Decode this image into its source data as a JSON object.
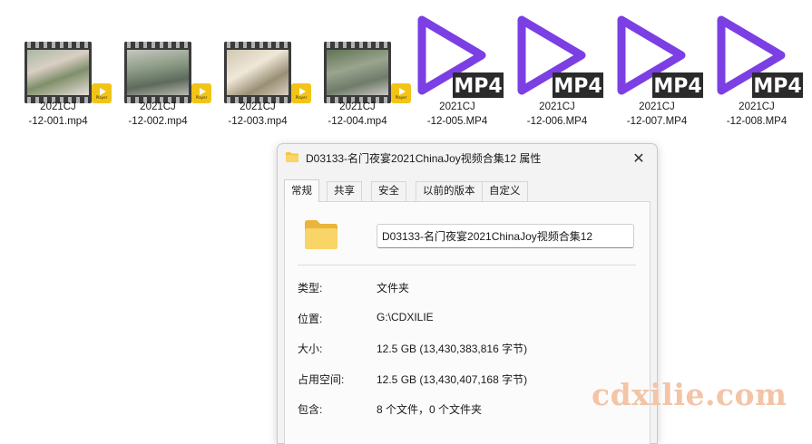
{
  "files": [
    {
      "line1": "2021CJ",
      "line2": "-12-001.mp4",
      "icon": "video-thumbnail",
      "badge": "Player"
    },
    {
      "line1": "2021CJ",
      "line2": "-12-002.mp4",
      "icon": "video-thumbnail",
      "badge": "Player"
    },
    {
      "line1": "2021CJ",
      "line2": "-12-003.mp4",
      "icon": "video-thumbnail",
      "badge": "Player"
    },
    {
      "line1": "2021CJ",
      "line2": "-12-004.mp4",
      "icon": "video-thumbnail",
      "badge": "Player"
    },
    {
      "line1": "2021CJ",
      "line2": "-12-005.MP4",
      "icon": "mp4-play-icon",
      "badge": "MP4"
    },
    {
      "line1": "2021CJ",
      "line2": "-12-006.MP4",
      "icon": "mp4-play-icon",
      "badge": "MP4"
    },
    {
      "line1": "2021CJ",
      "line2": "-12-007.MP4",
      "icon": "mp4-play-icon",
      "badge": "MP4"
    },
    {
      "line1": "2021CJ",
      "line2": "-12-008.MP4",
      "icon": "mp4-play-icon",
      "badge": "MP4"
    }
  ],
  "dialog": {
    "title": "D03133-名门夜宴2021ChinaJoy视频合集12 属性",
    "close_label": "✕",
    "tabs": [
      "常规",
      "共享",
      "安全",
      "以前的版本",
      "自定义"
    ],
    "active_tab": "常规",
    "folder_name": "D03133-名门夜宴2021ChinaJoy视频合集12",
    "properties": [
      {
        "label": "类型:",
        "value": "文件夹"
      },
      {
        "label": "位置:",
        "value": "G:\\CDXILIE"
      },
      {
        "label": "大小:",
        "value": "12.5 GB (13,430,383,816 字节)"
      },
      {
        "label": "占用空间:",
        "value": "12.5 GB (13,430,407,168 字节)"
      },
      {
        "label": "包含:",
        "value": "8 个文件，0 个文件夹"
      }
    ]
  },
  "watermark": "cdxilie.com",
  "colors": {
    "mp4_purple": "#7b3fe4",
    "badge_yellow": "#f2c418",
    "folder_yellow": "#f4c542",
    "watermark": "#f3c4a6"
  }
}
